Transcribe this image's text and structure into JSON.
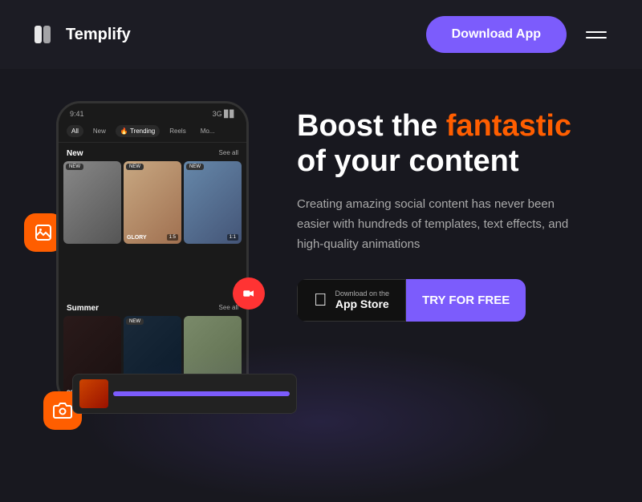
{
  "header": {
    "logo_text": "Templify",
    "download_btn_label": "Download App",
    "menu_label": "Menu"
  },
  "hero": {
    "heading_part1": "Boost the ",
    "heading_highlight": "fantastic",
    "heading_part2": "of your content",
    "description": "Creating amazing social content has never been easier with hundreds of templates, text effects, and high-quality animations",
    "app_store_sub": "Download on the",
    "app_store_main": "App Store",
    "try_btn_label": "TRY FOR FREE"
  },
  "phone": {
    "status_left": "9:41",
    "status_right": "3G 📶",
    "tabs": [
      "All",
      "New",
      "🔥 Trending",
      "Reels",
      "Mo..."
    ],
    "section1_title": "New",
    "section1_see_all": "See all",
    "cards_row1": [
      {
        "badge": "NEW",
        "label": "",
        "counter": ""
      },
      {
        "badge": "NEW",
        "label": "GLORY",
        "counter": "1:5"
      },
      {
        "badge": "NEW",
        "label": "",
        "counter": "1:1"
      }
    ],
    "section2_title": "Summer",
    "section2_see_all": "See all",
    "cards_row2": [
      {
        "badge": "",
        "label": "COACHELLA 2023",
        "counter": ""
      },
      {
        "badge": "NEW",
        "label": "",
        "counter": ""
      },
      {
        "badge": "",
        "label": "",
        "counter": ""
      }
    ]
  }
}
